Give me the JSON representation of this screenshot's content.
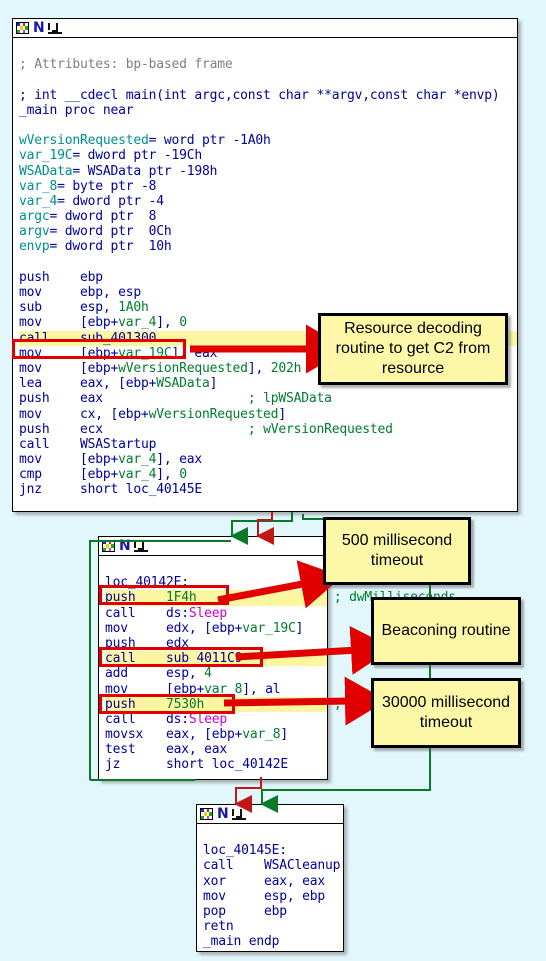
{
  "window": {
    "title_icon": "ida-graph-icon",
    "title_letter": "N",
    "graph_glyph": "graph-icon"
  },
  "colors": {
    "background": "#e2f7fc",
    "node_bg": "#ffffff",
    "code_text": "#00009c",
    "comment": "#7f7f7f",
    "variable": "#007c2f",
    "import": "#cc00cc",
    "highlight_bg": "#fdf6a0",
    "highlight_border": "#e00000",
    "callout_bg": "#fdf8a8",
    "edge_green": "#0a7a28",
    "edge_red": "#c01818"
  },
  "blocks": {
    "main": {
      "name": "_main function block",
      "lines": [
        {
          "t": "blank",
          "text": ""
        },
        {
          "t": "comment",
          "text": "; Attributes: bp-based frame"
        },
        {
          "t": "blank",
          "text": ""
        },
        {
          "t": "comment",
          "text": "; int __cdecl main(int argc,const char **argv,const char *envp)",
          "color": "code"
        },
        {
          "t": "plain",
          "text": "_main proc near"
        },
        {
          "t": "blank",
          "text": ""
        },
        {
          "t": "var",
          "mnem": "wVersionRequested",
          "rest": "= word ptr -1A0h"
        },
        {
          "t": "var",
          "mnem": "var_19C",
          "rest": "= dword ptr -19Ch"
        },
        {
          "t": "var",
          "mnem": "WSAData",
          "rest": "= WSAData ptr -198h"
        },
        {
          "t": "var",
          "mnem": "var_8",
          "rest": "= byte ptr -8"
        },
        {
          "t": "var",
          "mnem": "var_4",
          "rest": "= dword ptr -4"
        },
        {
          "t": "var",
          "mnem": "argc",
          "rest": "= dword ptr  8"
        },
        {
          "t": "var",
          "mnem": "argv",
          "rest": "= dword ptr  0Ch"
        },
        {
          "t": "var",
          "mnem": "envp",
          "rest": "= dword ptr  10h"
        },
        {
          "t": "blank",
          "text": ""
        },
        {
          "t": "ins",
          "mnem": "push",
          "ops": "ebp"
        },
        {
          "t": "ins",
          "mnem": "mov",
          "ops": "ebp, esp"
        },
        {
          "t": "ins",
          "mnem": "sub",
          "ops": "esp, 1A0h"
        },
        {
          "t": "ins",
          "mnem": "mov",
          "ops": "[ebp+var_4], 0"
        },
        {
          "t": "ins",
          "mnem": "call",
          "ops": "sub_401300",
          "highlight": true
        },
        {
          "t": "ins",
          "mnem": "mov",
          "ops": "[ebp+var_19C], eax"
        },
        {
          "t": "ins",
          "mnem": "mov",
          "ops": "[ebp+wVersionRequested], 202h"
        },
        {
          "t": "ins",
          "mnem": "lea",
          "ops": "eax, [ebp+WSAData]"
        },
        {
          "t": "ins",
          "mnem": "push",
          "ops": "eax",
          "comment": "; lpWSAData"
        },
        {
          "t": "ins",
          "mnem": "mov",
          "ops": "cx, [ebp+wVersionRequested]"
        },
        {
          "t": "ins",
          "mnem": "push",
          "ops": "ecx",
          "comment": "; wVersionRequested"
        },
        {
          "t": "ins",
          "mnem": "call",
          "ops": "WSAStartup"
        },
        {
          "t": "ins",
          "mnem": "mov",
          "ops": "[ebp+var_4], eax"
        },
        {
          "t": "ins",
          "mnem": "cmp",
          "ops": "[ebp+var_4], 0"
        },
        {
          "t": "ins",
          "mnem": "jnz",
          "ops": "short loc_40145E"
        }
      ]
    },
    "loop": {
      "name": "beaconing loop block",
      "lines": [
        {
          "t": "blank",
          "text": ""
        },
        {
          "t": "label",
          "text": "loc_40142E:"
        },
        {
          "t": "ins",
          "mnem": "push",
          "ops": "1F4h",
          "comment": "; dwMilliseconds",
          "highlight": true
        },
        {
          "t": "ins",
          "mnem": "call",
          "ops": "ds:Sleep"
        },
        {
          "t": "ins",
          "mnem": "mov",
          "ops": "edx, [ebp+var_19C]"
        },
        {
          "t": "ins",
          "mnem": "push",
          "ops": "edx"
        },
        {
          "t": "ins",
          "mnem": "call",
          "ops": "sub_4011C9",
          "highlight": true
        },
        {
          "t": "ins",
          "mnem": "add",
          "ops": "esp, 4"
        },
        {
          "t": "ins",
          "mnem": "mov",
          "ops": "[ebp+var_8], al"
        },
        {
          "t": "ins",
          "mnem": "push",
          "ops": "7530h",
          "comment": "; dwMilliseconds",
          "highlight": true
        },
        {
          "t": "ins",
          "mnem": "call",
          "ops": "ds:Sleep"
        },
        {
          "t": "ins",
          "mnem": "movsx",
          "ops": "eax, [ebp+var_8]"
        },
        {
          "t": "ins",
          "mnem": "test",
          "ops": "eax, eax"
        },
        {
          "t": "ins",
          "mnem": "jz",
          "ops": "short loc_40142E"
        }
      ]
    },
    "exit": {
      "name": "cleanup / return block",
      "lines": [
        {
          "t": "blank",
          "text": ""
        },
        {
          "t": "label",
          "text": "loc_40145E:"
        },
        {
          "t": "ins",
          "mnem": "call",
          "ops": "WSACleanup"
        },
        {
          "t": "ins",
          "mnem": "xor",
          "ops": "eax, eax"
        },
        {
          "t": "ins",
          "mnem": "mov",
          "ops": "esp, ebp"
        },
        {
          "t": "ins",
          "mnem": "pop",
          "ops": "ebp"
        },
        {
          "t": "ins",
          "mnem": "retn",
          "ops": ""
        },
        {
          "t": "plain",
          "text": "_main endp"
        }
      ]
    }
  },
  "callouts": {
    "resource": "Resource decoding routine to get C2 from resource",
    "timeout500": "500 millisecond timeout",
    "beacon": "Beaconing routine",
    "timeout30000": "30000 millisecond timeout"
  }
}
